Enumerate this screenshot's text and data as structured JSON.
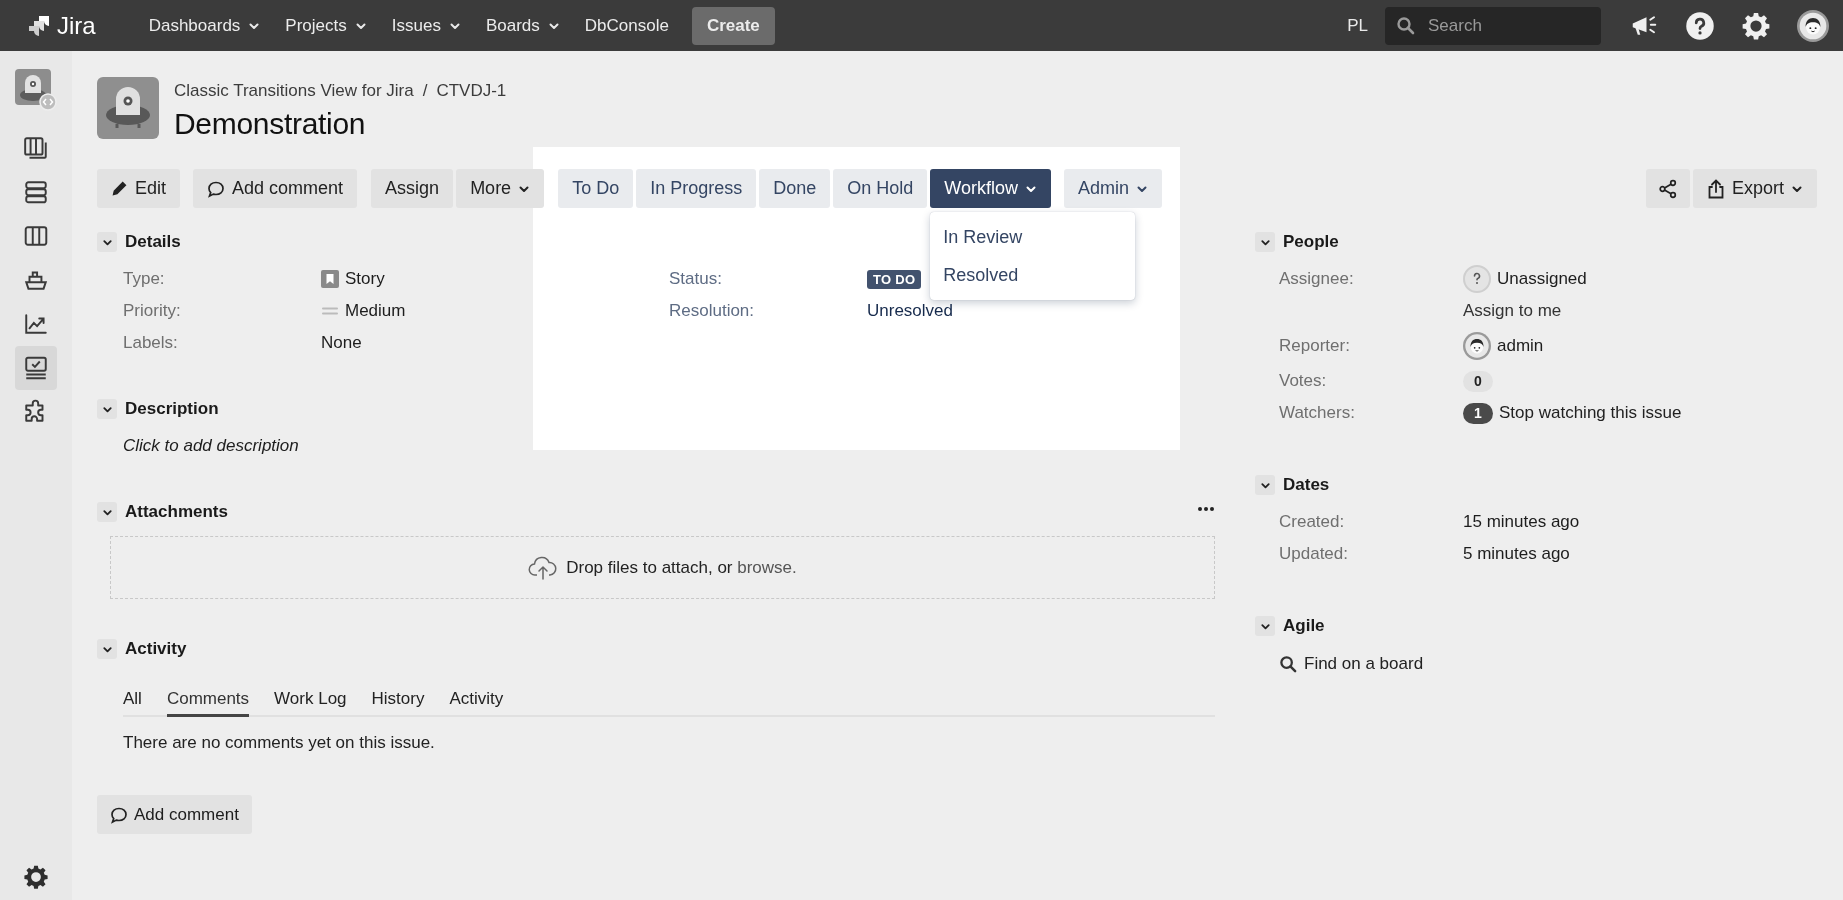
{
  "topbar": {
    "logo": "Jira",
    "nav": [
      {
        "label": "Dashboards",
        "dropdown": true
      },
      {
        "label": "Projects",
        "dropdown": true
      },
      {
        "label": "Issues",
        "dropdown": true
      },
      {
        "label": "Boards",
        "dropdown": true
      },
      {
        "label": "DbConsole",
        "dropdown": false
      }
    ],
    "create": "Create",
    "language": "PL",
    "search": {
      "placeholder": "Search"
    }
  },
  "sidebar": {
    "items": [
      {
        "kind": "project",
        "selected": false
      },
      {
        "kind": "backlog",
        "selected": false
      },
      {
        "kind": "stack",
        "selected": false
      },
      {
        "kind": "board",
        "selected": false
      },
      {
        "kind": "ship",
        "selected": false
      },
      {
        "kind": "reports",
        "selected": false
      },
      {
        "kind": "checklist",
        "selected": true
      },
      {
        "kind": "apps",
        "selected": false
      }
    ]
  },
  "breadcrumbs": {
    "items": [
      "Classic Transitions View for Jira",
      "CTVDJ-1"
    ],
    "separator": "/"
  },
  "summary": "Demonstration",
  "toolbar": {
    "actions": [
      {
        "kind": "edit",
        "label": "Edit"
      },
      {
        "kind": "comment",
        "label": "Add comment"
      },
      {
        "kind": "plain",
        "label": "Assign"
      },
      {
        "kind": "dropdown",
        "label": "More"
      }
    ],
    "transitions": [
      {
        "label": "To Do",
        "dropdown": false,
        "expanded": false
      },
      {
        "label": "In Progress",
        "dropdown": false,
        "expanded": false
      },
      {
        "label": "Done",
        "dropdown": false,
        "expanded": false
      },
      {
        "label": "On Hold",
        "dropdown": false,
        "expanded": false
      },
      {
        "label": "Workflow",
        "dropdown": true,
        "expanded": true,
        "menu": [
          "In Review",
          "Resolved"
        ]
      },
      {
        "label": "Admin",
        "dropdown": true,
        "expanded": false
      }
    ],
    "export": "Export"
  },
  "main_sections": [
    {
      "kind": "details",
      "title": "Details",
      "expanded": true,
      "fields": [
        {
          "kind": "type",
          "label": "Type:",
          "value": "Story"
        },
        {
          "kind": "priority",
          "label": "Priority:",
          "value": "Medium"
        },
        {
          "kind": "text",
          "label": "Labels:",
          "value": "None"
        }
      ],
      "status_fields": [
        {
          "kind": "lozenge",
          "label": "Status:",
          "value": "TO DO"
        },
        {
          "kind": "text",
          "label": "Resolution:",
          "value": "Unresolved"
        }
      ]
    },
    {
      "kind": "description",
      "title": "Description",
      "expanded": true,
      "placeholder": "Click to add description"
    },
    {
      "kind": "attachments",
      "title": "Attachments",
      "expanded": true,
      "drop_text": "Drop files to attach, or",
      "browse": "browse."
    },
    {
      "kind": "activity",
      "title": "Activity",
      "expanded": true,
      "tabs": [
        {
          "label": "All",
          "selected": false
        },
        {
          "label": "Comments",
          "selected": true
        },
        {
          "label": "Work Log",
          "selected": false
        },
        {
          "label": "History",
          "selected": false
        },
        {
          "label": "Activity",
          "selected": false
        }
      ],
      "empty_message": "There are no comments yet on this issue.",
      "add_comment": "Add comment"
    }
  ],
  "side_sections": [
    {
      "kind": "people",
      "title": "People",
      "expanded": true,
      "fields": [
        {
          "kind": "unassigned",
          "label": "Assignee:",
          "value": "Unassigned",
          "action": "Assign to me"
        },
        {
          "kind": "user",
          "label": "Reporter:",
          "value": "admin"
        },
        {
          "kind": "votes",
          "label": "Votes:",
          "count": "0"
        },
        {
          "kind": "watchers",
          "label": "Watchers:",
          "count": "1",
          "action": "Stop watching this issue"
        }
      ]
    },
    {
      "kind": "dates",
      "title": "Dates",
      "expanded": true,
      "fields": [
        {
          "label": "Created:",
          "value": "15 minutes ago"
        },
        {
          "label": "Updated:",
          "value": "5 minutes ago"
        }
      ]
    },
    {
      "kind": "agile",
      "title": "Agile",
      "expanded": true,
      "link": "Find on a board"
    }
  ]
}
